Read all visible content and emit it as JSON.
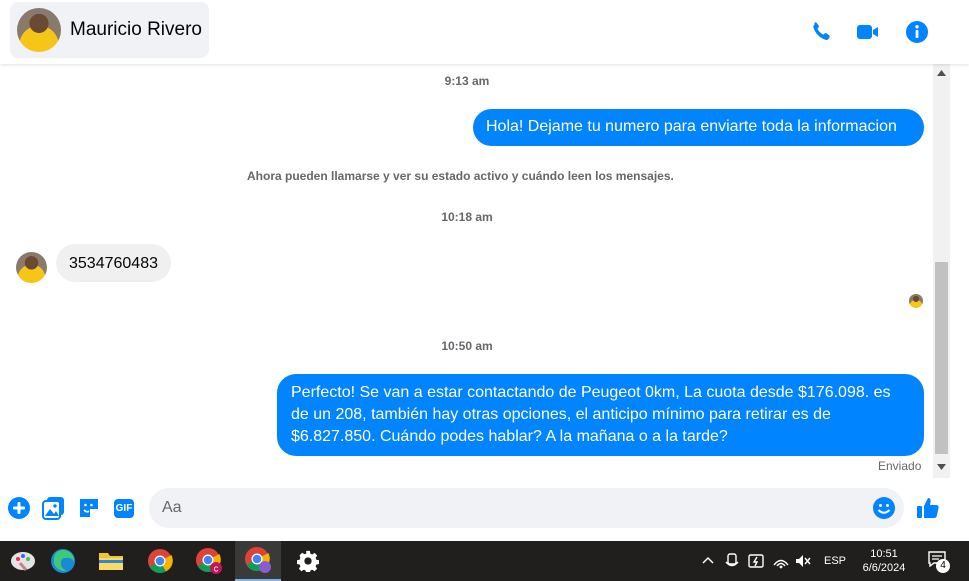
{
  "header": {
    "contact_name": "Mauricio Rivero",
    "icons": [
      "phone-icon",
      "video-icon",
      "info-icon"
    ],
    "accent": "#0084ff"
  },
  "chat": {
    "timestamps": [
      "9:13 am",
      "10:18 am",
      "10:50 am"
    ],
    "outgoing_1": "Hola! Dejame tu numero para enviarte toda la informacion",
    "system_notice": "Ahora pueden llamarse y ver su estado activo y cuándo leen los mensajes.",
    "incoming_1": "3534760483",
    "outgoing_2_lines": [
      "Perfecto!  Se van a estar contactando de Peugeot 0km, La cuota desde $176.098. es",
      "de un 208, también hay otras opciones, el anticipo mínimo para retirar es de",
      "$6.827.850. Cuándo podes hablar? A la mañana o a la tarde?"
    ],
    "status": "Enviado"
  },
  "composer": {
    "placeholder": "Aa",
    "icons": [
      "add-icon",
      "image-icon",
      "sticker-icon",
      "gif-icon",
      "emoji-icon",
      "like-icon"
    ],
    "gif_label": "GIF"
  },
  "taskbar": {
    "language": "ESP",
    "time": "10:51",
    "date": "6/6/2024",
    "notification_count": "4"
  }
}
